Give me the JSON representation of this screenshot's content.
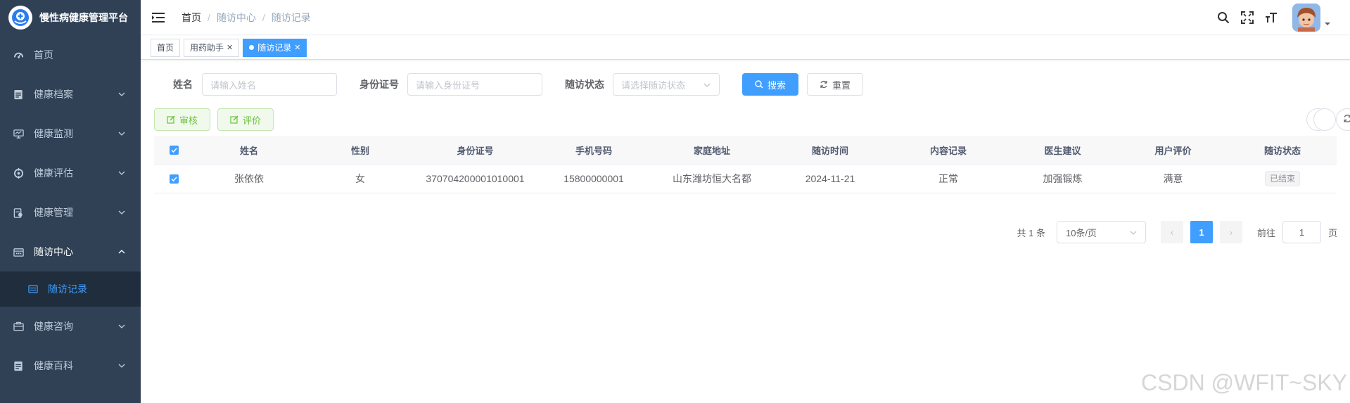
{
  "app": {
    "title": "慢性病健康管理平台"
  },
  "sidebar": {
    "items": [
      {
        "label": "首页"
      },
      {
        "label": "健康档案"
      },
      {
        "label": "健康监测"
      },
      {
        "label": "健康评估"
      },
      {
        "label": "健康管理"
      },
      {
        "label": "随访中心",
        "children": [
          {
            "label": "随访记录"
          }
        ]
      },
      {
        "label": "健康咨询"
      },
      {
        "label": "健康百科"
      }
    ]
  },
  "breadcrumb": [
    "首页",
    "随访中心",
    "随访记录"
  ],
  "tags": [
    {
      "label": "首页"
    },
    {
      "label": "用药助手"
    },
    {
      "label": "随访记录"
    }
  ],
  "search": {
    "name_label": "姓名",
    "name_placeholder": "请输入姓名",
    "id_label": "身份证号",
    "id_placeholder": "请输入身份证号",
    "status_label": "随访状态",
    "status_placeholder": "请选择随访状态",
    "search_btn": "搜索",
    "reset_btn": "重置"
  },
  "toolbar": {
    "review_btn": "审核",
    "evaluate_btn": "评价"
  },
  "table": {
    "columns": [
      "姓名",
      "性别",
      "身份证号",
      "手机号码",
      "家庭地址",
      "随访时间",
      "内容记录",
      "医生建议",
      "用户评价",
      "随访状态"
    ],
    "rows": [
      {
        "name": "张依依",
        "gender": "女",
        "id": "370704200001010001",
        "phone": "15800000001",
        "address": "山东潍坊恒大名都",
        "time": "2024-11-21",
        "record": "正常",
        "advice": "加强锻炼",
        "rating": "满意",
        "status": "已结束"
      }
    ]
  },
  "pagination": {
    "total_text": "共 1 条",
    "page_size": "10条/页",
    "current_page": "1",
    "goto_label": "前往",
    "goto_value": "1",
    "page_suffix": "页"
  },
  "watermark": "CSDN @WFIT~SKY",
  "colors": {
    "sidebar_bg": "#304156",
    "primary": "#409eff",
    "success": "#67c23a"
  }
}
